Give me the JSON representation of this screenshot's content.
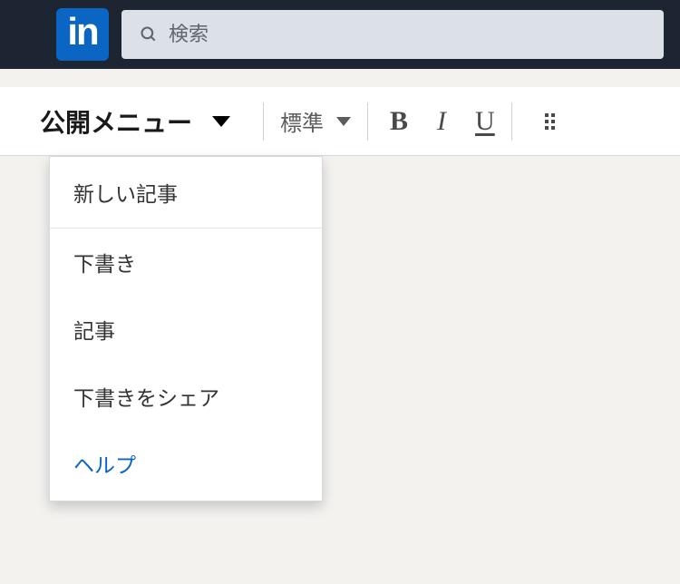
{
  "header": {
    "logo_text": "in",
    "search": {
      "placeholder": "検索"
    }
  },
  "toolbar": {
    "publish_menu": {
      "label": "公開メニュー"
    },
    "style_menu": {
      "label": "標準"
    },
    "format": {
      "bold": "B",
      "italic": "I",
      "underline": "U"
    }
  },
  "dropdown": {
    "items": [
      {
        "label": "新しい記事"
      },
      {
        "label": "下書き"
      },
      {
        "label": "記事"
      },
      {
        "label": "下書きをシェア"
      },
      {
        "label": "ヘルプ"
      }
    ]
  }
}
